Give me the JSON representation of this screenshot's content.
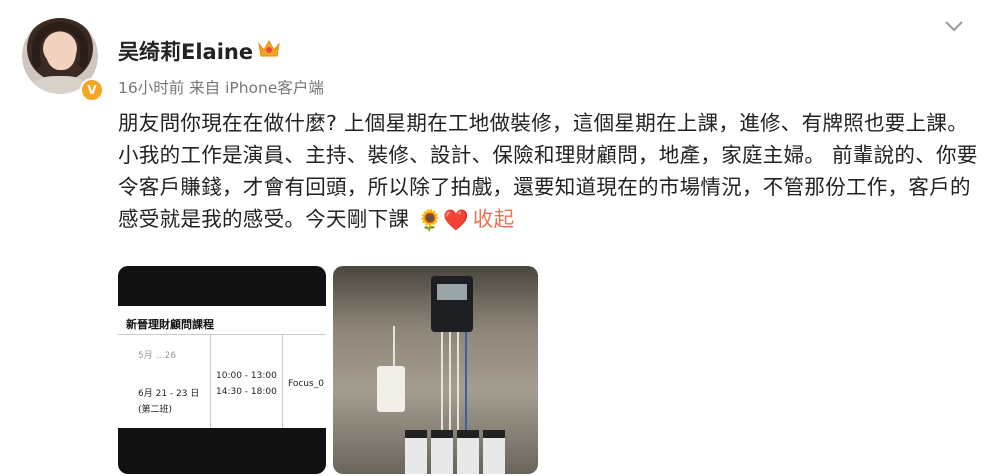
{
  "post": {
    "username": "吴绮莉Elaine",
    "meta": "16小时前 来自 iPhone客户端",
    "verified_badge": "V",
    "text": "朋友問你現在在做什麼? 上個星期在工地做裝修，這個星期在上課，進修、有牌照也要上課。小我的工作是演員、主持、裝修、設計、保險和理財顧問，地產，家庭主婦。 前輩說的、你要令客戶賺錢，才會有回頭，所以除了拍戲，還要知道現在的市場情況，不管那份工作，客戶的感受就是我的感受。今天剛下課",
    "emojis": "🌻❤️",
    "collapse_label": "收起",
    "accent_color": "#eb7350"
  },
  "image1": {
    "title": "新晉理財顧問課程",
    "date_partial": "5月 …26",
    "date": "6月 21 - 23 日",
    "class_label": "(第二班)",
    "time1": "10:00 - 13:00",
    "time2": "14:30 - 18:00",
    "venue": "Focus_0"
  },
  "icons": {
    "crown": "crown-icon",
    "chevron": "chevron-down-icon",
    "verified": "verified-badge-icon"
  }
}
